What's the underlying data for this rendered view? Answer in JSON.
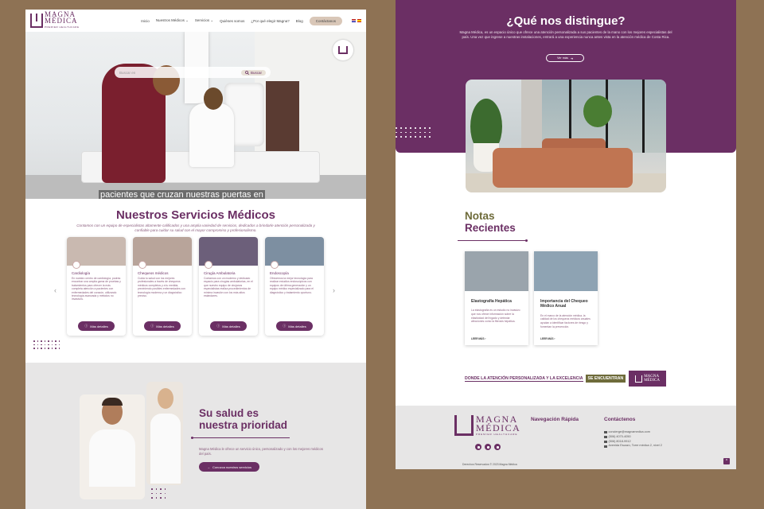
{
  "brand": {
    "line1": "MAGNA",
    "line2": "MÉDICA",
    "tagline": "PREMIER HEALTHCARE"
  },
  "nav": {
    "items": [
      "Inicio",
      "Nuestros Médicos",
      "Servicios",
      "Quiénes somos",
      "¿Por qué elegir Magna?",
      "Blog"
    ],
    "contact_button": "Contáctanos"
  },
  "hero": {
    "search_placeholder": "Buscar en",
    "search_button": "Buscar",
    "caption": "pacientes que cruzan nuestras puertas en"
  },
  "services": {
    "title": "Nuestros Servicios Médicos",
    "description": "Contamos con un equipo de especialistas altamente calificados y una amplia variedad de servicios, dedicados a brindarle atención personalizada y confiable para cuidar su salud con el mayor compromiso y profesionalismo.",
    "button": "Más detalles",
    "cards": [
      {
        "title": "Cardiología",
        "text": "En nuestro centro de cardiología, podrás encontrar una amplia gama de pruebas y tratamientos para ofrecer la más completa atención a pacientes con enfermedades del corazón, utilizando tecnología avanzada y métodos no invasivos.",
        "color": "#c9b9b0"
      },
      {
        "title": "Chequeos médicos",
        "text": "Cuida tu salud con los mejores profesionales a través de chequeos médicos completos y a tu medida, previniendo posibles enfermedades con tecnología moderna y un diagnóstico preciso.",
        "color": "#b8a49a"
      },
      {
        "title": "Cirugía Ambulatoria",
        "text": "Contamos con un moderno y dedicado espacio para cirugías ambulatorias, en el que nuestro equipo de cirujanos especialistas realiza procedimientos de mínima invasión con los más altos estándares.",
        "color": "#6c5f7a"
      },
      {
        "title": "Endoscopía",
        "text": "Ofrecemos la mejor tecnología para realizar estudios endoscópicos con equipos de última generación y un equipo médico especializado para el diagnóstico y tratamiento oportuno.",
        "color": "#7d8fa1"
      }
    ]
  },
  "health": {
    "title_line1": "Su salud es",
    "title_line2": "nuestra prioridad",
    "text": "Magna Médica le ofrece un servicio único, personalizado y con los mejores médicos del país.",
    "button": "Conozca nuestros servicios"
  },
  "distingue": {
    "title": "¿Qué nos distingue?",
    "text": "Magna Médica, es un espacio único que ofrece una atención personalizada a sus pacientes de la mano con los mejores especialistas del país. Una vez que ingrese a nuestras instalaciones, entrará a una experiencia nunca antes vista en la atención médica de Costa Rica.",
    "button": "Ver más"
  },
  "notes": {
    "title_line1": "Notas",
    "title_line2": "Recientes",
    "read_more": "LEER MÁS ›",
    "items": [
      {
        "title": "Elastografía Hepática",
        "text": "La elastografía es un estudio no invasivo que nos ofrece información sobre la elasticidad del hígado y detectar afecciones como la fibrosis hepática.",
        "color": "#9aa4ac"
      },
      {
        "title": "Importancia del Chequeo Médico Anual",
        "text": "En el marco de la atención médica, la calidad de los chequeos médicos anuales ayudan a identificar factores de riesgo y fomentan la prevención.",
        "color": "#8ea3b3"
      }
    ]
  },
  "banner": {
    "text": "DONDE LA ATENCIÓN PERSONALIZADA Y LA EXCELENCIA",
    "highlight": "SE ENCUENTRAN",
    "logo_line1": "MAGNA",
    "logo_line2": "MÉDICA"
  },
  "footer": {
    "nav_heading": "Navegación Rápida",
    "contact_heading": "Contáctenos",
    "contacts": [
      "concierge@magnamedica.com",
      "(506) 4070-4050",
      "(506) 8018-9912",
      "Avenida Escazú, Torre médica 2, nivel 2"
    ],
    "copyright": "Derechos Reservados © 2023 Magna Médica",
    "to_top": "^"
  },
  "colors": {
    "primary": "#6b2f64",
    "olive": "#6e6b3a",
    "background": "#8e7254"
  }
}
